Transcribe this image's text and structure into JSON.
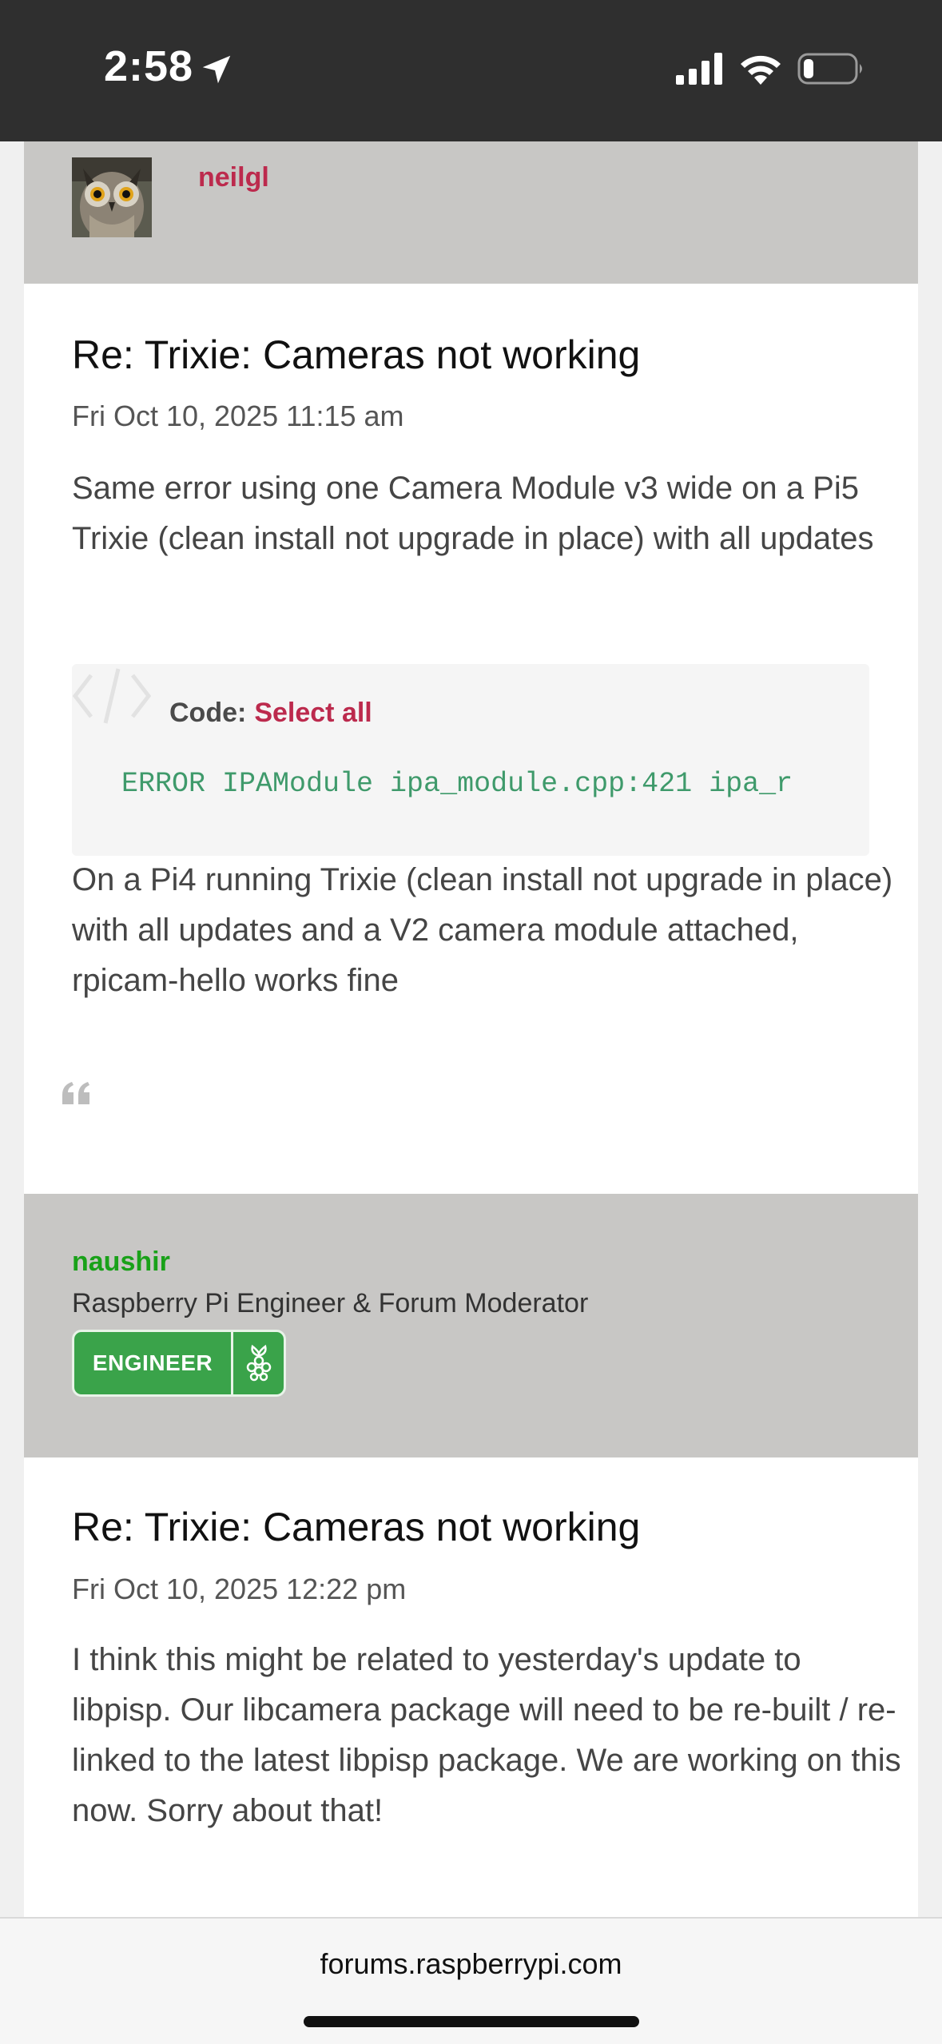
{
  "status_bar": {
    "time": "2:58"
  },
  "posts": [
    {
      "author": "neilgl",
      "title": "Re: Trixie: Cameras not working",
      "date": "Fri Oct 10, 2025 11:15 am",
      "paragraph1": "Same error using one Camera Module v3 wide on a Pi5 Trixie (clean install not upgrade in place) with all updates",
      "code_label": "Code:",
      "select_all": "Select all",
      "code": "ERROR IPAModule ipa_module.cpp:421 ipa_r",
      "paragraph2": "On a Pi4 running Trixie (clean install not upgrade in place) with all updates and a V2 camera module attached, rpicam-hello works fine"
    },
    {
      "author": "naushir",
      "rank": "Raspberry Pi Engineer & Forum Moderator",
      "badge": "ENGINEER",
      "title": "Re: Trixie: Cameras not working",
      "date": "Fri Oct 10, 2025 12:22 pm",
      "paragraph1": "I think this might be related to yesterday's update to libpisp. Our libcamera package will need to be re-built / re-linked to the latest libpisp package. We are working on this now. Sorry about that!"
    }
  ],
  "browser": {
    "url": "forums.raspberrypi.com"
  },
  "colors": {
    "author_red": "#bc2a4d",
    "author_green": "#19a119",
    "badge_green": "#3aa34a",
    "header_gray": "#c8c7c5"
  }
}
